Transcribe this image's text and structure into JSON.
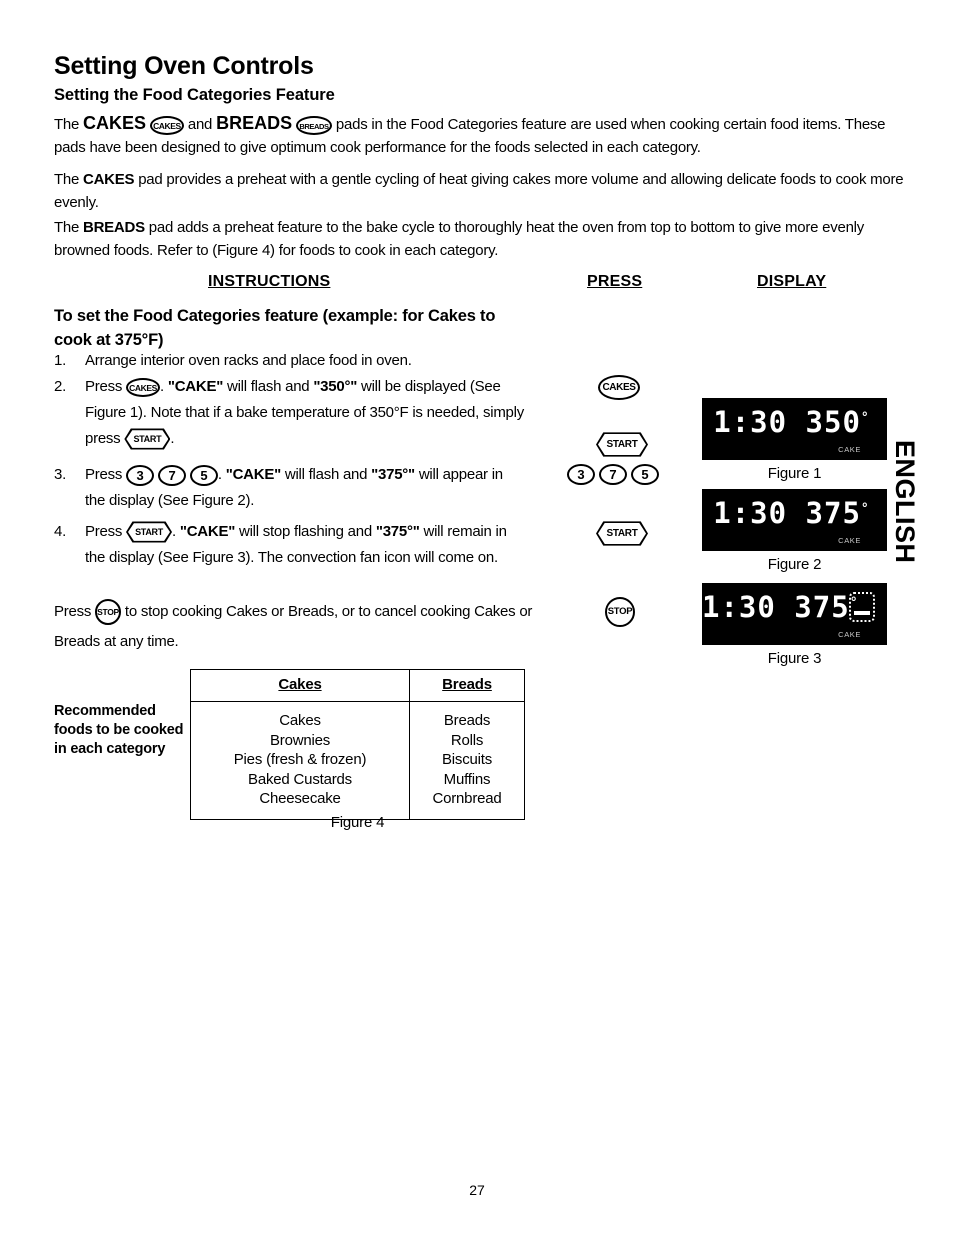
{
  "document": {
    "title": "Setting Oven Controls",
    "subtitle": "Setting the Food Categories Feature",
    "page_number": "27",
    "language_tab": "ENGLISH"
  },
  "intro": {
    "para1_a": "The ",
    "para1_cakes": "CAKES",
    "para1_b": " and ",
    "para1_breads": "BREADS",
    "para1_c": " pads in the Food Categories feature are used when cooking certain food items. These pads have been designed to give optimum cook performance for the foods selected in each category.",
    "para2_a": "The ",
    "para2_b": "CAKES",
    "para2_c": " pad provides a preheat with a gentle cycling of heat giving cakes more volume and allowing delicate foods to cook more evenly.",
    "para3_a": "The ",
    "para3_b": "BREADS",
    "para3_c": " pad adds a preheat feature to the bake cycle to thoroughly heat the oven from top to bottom to give more evenly browned foods. Refer to (Figure 4) for foods to cook in each category."
  },
  "columns": {
    "instructions": "INSTRUCTIONS",
    "press": "PRESS",
    "display": "DISPLAY"
  },
  "procedure": {
    "heading": "To set the Food Categories feature (example: for Cakes to cook  at 375°F)",
    "step1": {
      "num": "1.",
      "text": "Arrange interior oven racks and place food in oven."
    },
    "step2": {
      "num": "2.",
      "a": "Press ",
      "pad": "CAKES",
      "b": ". ",
      "quoted1": "\"CAKE\"",
      "c": " will flash and ",
      "quoted2": "\"350°\"",
      "d": " will be displayed (See Figure 1). Note that if a bake temperature of 350°F is needed, simply press ",
      "pad2": "START",
      "e": "."
    },
    "step3": {
      "num": "3.",
      "a": "Press ",
      "digit1": "3",
      "digit2": "7",
      "digit3": "5",
      "b": ". ",
      "quoted1": "\"CAKE\"",
      "c": " will flash and ",
      "quoted2": "\"375°\"",
      "d": " will appear in the display (See Figure 2)."
    },
    "step4": {
      "num": "4.",
      "a": "Press ",
      "pad": "START",
      "b": ". ",
      "quoted1": "\"CAKE\"",
      "c": " will stop flashing and ",
      "quoted2": "\"375°\"",
      "d": "  will remain in the display (See Figure 3). The convection fan icon will come on."
    },
    "stop_note": {
      "a": "Press ",
      "pad": "STOP",
      "b": " to stop cooking Cakes or Breads, or to cancel cooking Cakes or Breads at any time."
    }
  },
  "press_column": {
    "cakes": "CAKES",
    "start1": "START",
    "digits": [
      "3",
      "7",
      "5"
    ],
    "start2": "START",
    "stop": "STOP"
  },
  "displays": [
    {
      "readout": "1:30 350",
      "degree": "°",
      "mode": "CAKE",
      "fan_icon": false,
      "caption": "Figure 1"
    },
    {
      "readout": "1:30 375",
      "degree": "°",
      "mode": "CAKE",
      "fan_icon": true,
      "caption": "Figure 2"
    },
    {
      "readout": "1:30 375",
      "degree": "°",
      "mode": "CAKE",
      "fan_icon": true,
      "caption": "Figure 3"
    }
  ],
  "foods_table": {
    "side_label": "Recommended foods to be cooked in each category",
    "headers": [
      "Cakes",
      "Breads"
    ],
    "cakes": [
      "Cakes",
      "Brownies",
      "Pies (fresh & frozen)",
      "Baked Custards",
      "Cheesecake"
    ],
    "breads": [
      "Breads",
      "Rolls",
      "Biscuits",
      "Muffins",
      "Cornbread"
    ],
    "caption": "Figure 4"
  }
}
